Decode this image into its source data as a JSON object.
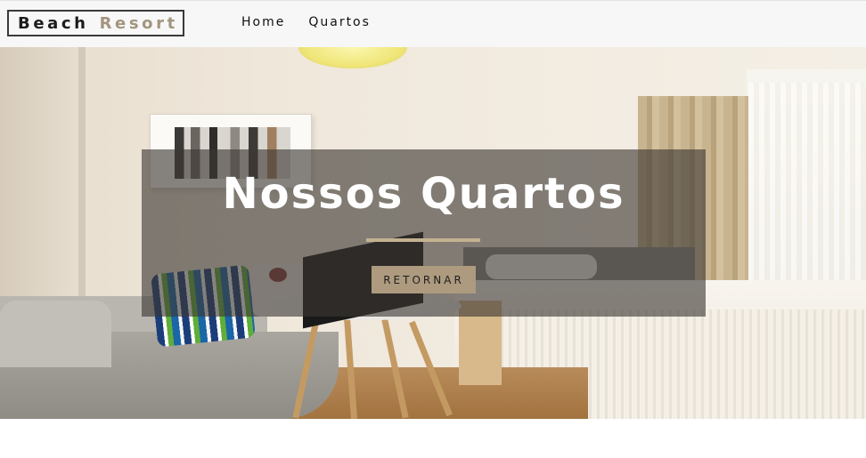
{
  "brand": {
    "word1": "Beach",
    "word2": "Resort"
  },
  "nav": {
    "items": [
      {
        "label": "Home"
      },
      {
        "label": "Quartos"
      }
    ]
  },
  "hero": {
    "title": "Nossos Quartos",
    "button_label": "RETORNAR",
    "image": "hotel-room-photo"
  },
  "colors": {
    "accent": "#ad9a7f",
    "divider": "#c3b190",
    "navbar_bg": "#f7f7f7",
    "overlay": "#3c3732"
  }
}
